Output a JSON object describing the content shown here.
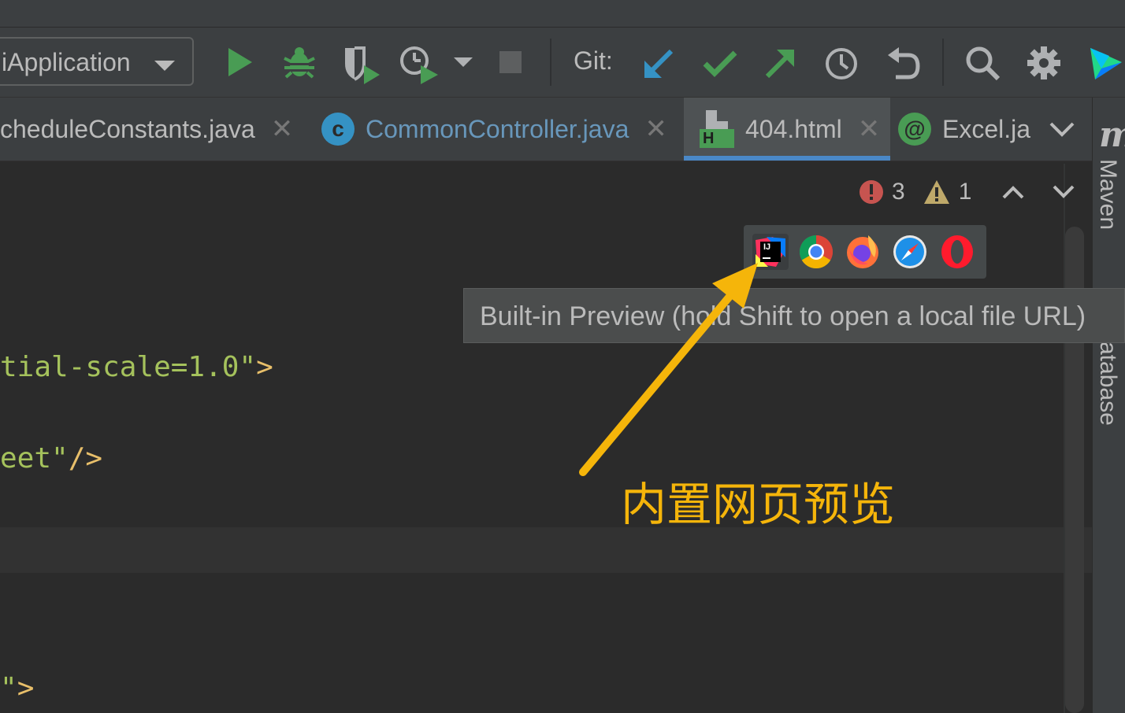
{
  "toolbar": {
    "run_config_label": "iApplication",
    "git_label": "Git:"
  },
  "tabs": [
    {
      "label": "cheduleConstants.java",
      "close": "✕"
    },
    {
      "label": "CommonController.java",
      "icon_letter": "c",
      "close": "✕"
    },
    {
      "label": "404.html",
      "icon_letter": "H",
      "close": "✕"
    },
    {
      "label": "Excel.ja",
      "icon_letter": "@"
    }
  ],
  "right_strip": {
    "maven_logo": "m",
    "maven_label": "Maven",
    "database_label": "atabase"
  },
  "inspection": {
    "errors": "3",
    "warnings": "1"
  },
  "browsers": [
    "intellij-icon",
    "chrome-icon",
    "firefox-icon",
    "safari-icon",
    "opera-icon"
  ],
  "browser_intellij_text": "IJ",
  "tooltip": {
    "text": "Built-in Preview (hold Shift to open a local file URL)"
  },
  "code": {
    "line1_value": "tial-scale=1.0\"",
    "line1_end": ">",
    "line2_value": "eet\"",
    "line2_end": "/>",
    "line3_value": "\"",
    "line3_end": ">"
  },
  "annotation": {
    "text": "内置网页预览",
    "color": "#f5b50a"
  },
  "colors": {
    "run_green": "#499c54",
    "git_blue": "#3592c4",
    "accent_underline": "#4a88c7",
    "error_red": "#c75450",
    "code_string": "#a5c25c",
    "code_tag": "#e8bf6a"
  }
}
